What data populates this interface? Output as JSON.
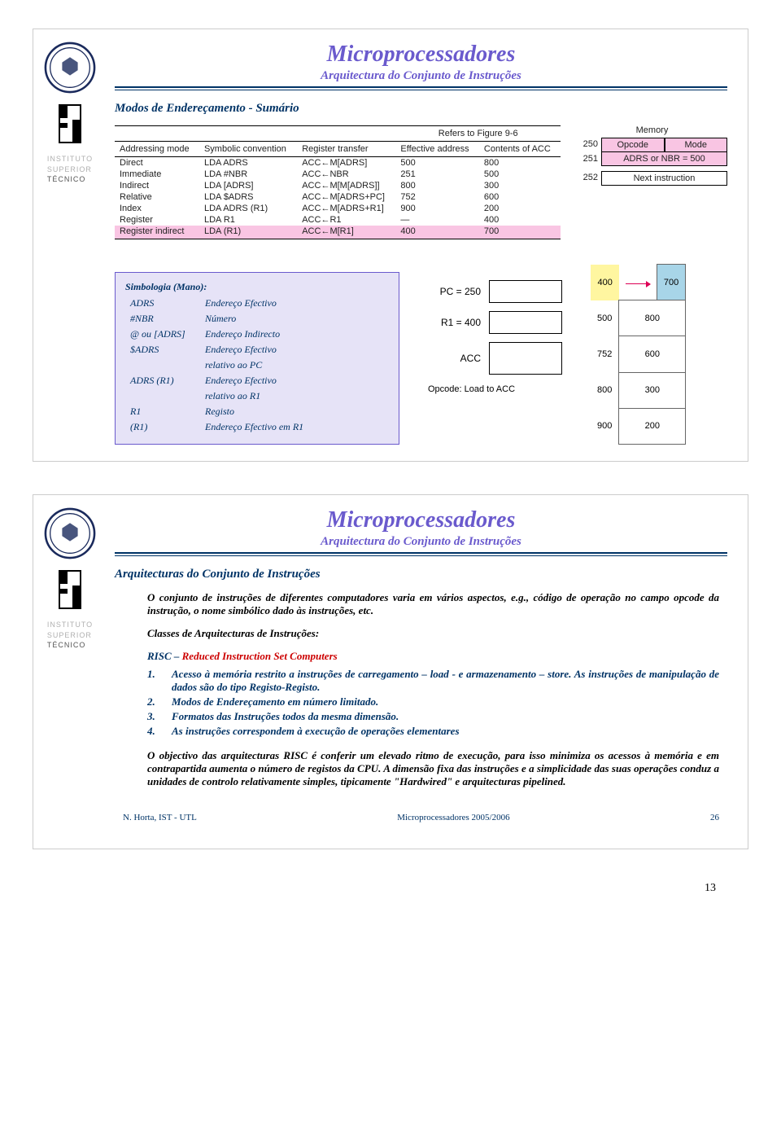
{
  "title": "Microprocessadores",
  "subtitle": "Arquitectura do Conjunto de Instruções",
  "inst_line1": "INSTITUTO",
  "inst_line2": "SUPERIOR",
  "inst_line3": "TÉCNICO",
  "slide1": {
    "section": "Modos de Endereçamento - Sumário",
    "table": {
      "ref": "Refers to Figure 9-6",
      "headers": [
        "Addressing mode",
        "Symbolic convention",
        "Register transfer",
        "Effective address",
        "Contents of ACC"
      ],
      "rows": [
        [
          "Direct",
          "LDA ADRS",
          "ACC←M[ADRS]",
          "500",
          "800"
        ],
        [
          "Immediate",
          "LDA #NBR",
          "ACC←NBR",
          "251",
          "500"
        ],
        [
          "Indirect",
          "LDA [ADRS]",
          "ACC←M[M[ADRS]]",
          "800",
          "300"
        ],
        [
          "Relative",
          "LDA $ADRS",
          "ACC←M[ADRS+PC]",
          "752",
          "600"
        ],
        [
          "Index",
          "LDA ADRS (R1)",
          "ACC←M[ADRS+R1]",
          "900",
          "200"
        ],
        [
          "Register",
          "LDA R1",
          "ACC←R1",
          "—",
          "400"
        ],
        [
          "Register indirect",
          "LDA (R1)",
          "ACC←M[R1]",
          "400",
          "700"
        ]
      ]
    },
    "mem_title": "Memory",
    "mem_rows": [
      {
        "addr": "250",
        "cells": [
          "Opcode",
          "Mode"
        ],
        "pink": true
      },
      {
        "addr": "251",
        "cells": [
          "ADRS or NBR = 500"
        ],
        "pink": true
      },
      {
        "addr": "252",
        "cells": [
          "Next instruction"
        ],
        "pink": false
      }
    ],
    "symbox_title": "Simbologia (Mano):",
    "sym_rows": [
      [
        "ADRS",
        "Endereço Efectivo"
      ],
      [
        "#NBR",
        "Número"
      ],
      [
        "@ ou [ADRS]",
        "Endereço Indirecto"
      ],
      [
        "$ADRS",
        "Endereço Efectivo\nrelativo ao PC"
      ],
      [
        "ADRS (R1)",
        "Endereço Efectivo\nrelativo ao R1"
      ],
      [
        "R1",
        "Registo"
      ],
      [
        "(R1)",
        "Endereço Efectivo em R1"
      ]
    ],
    "reg_pc": "PC = 250",
    "reg_r1": "R1 = 400",
    "reg_acc": "ACC",
    "opcode_cap": "Opcode: Load to ACC",
    "memtbl": [
      [
        "400",
        "",
        "700",
        "hide"
      ],
      [
        "500",
        "800"
      ],
      [
        "752",
        "600"
      ],
      [
        "800",
        "300"
      ],
      [
        "900",
        "200"
      ]
    ],
    "y400": "400",
    "b700": "700"
  },
  "slide2": {
    "section": "Arquitecturas do Conjunto de Instruções",
    "p1": "O conjunto de instruções de diferentes computadores varia em vários aspectos, e.g., código de operação no campo opcode da instrução, o nome simbólico dado às instruções, etc.",
    "p2": "Classes de Arquitecturas de Instruções:",
    "risc_label": "RISC – ",
    "risc_long": "Reduced Instruction Set Computers",
    "items": [
      "Acesso à memória restrito a instruções de carregamento – load - e armazenamento – store. As instruções de manipulação de dados são do tipo Registo-Registo.",
      "Modos de Endereçamento em número limitado.",
      "Formatos das Instruções todos da mesma dimensão.",
      "As instruções correspondem à execução de operações elementares"
    ],
    "p3": "O objectivo das arquitecturas RISC é conferir um elevado ritmo de execução, para isso minimiza os acessos à memória e em contrapartida aumenta o número de registos da CPU. A dimensão fixa das instruções e a simplicidade das suas operações conduz a unidades de controlo relativamente simples, tipicamente \"Hardwired\" e arquitecturas pipelined.",
    "footer_left": "N. Horta, IST - UTL",
    "footer_center": "Microprocessadores 2005/2006",
    "footer_right": "26"
  },
  "page_num": "13"
}
